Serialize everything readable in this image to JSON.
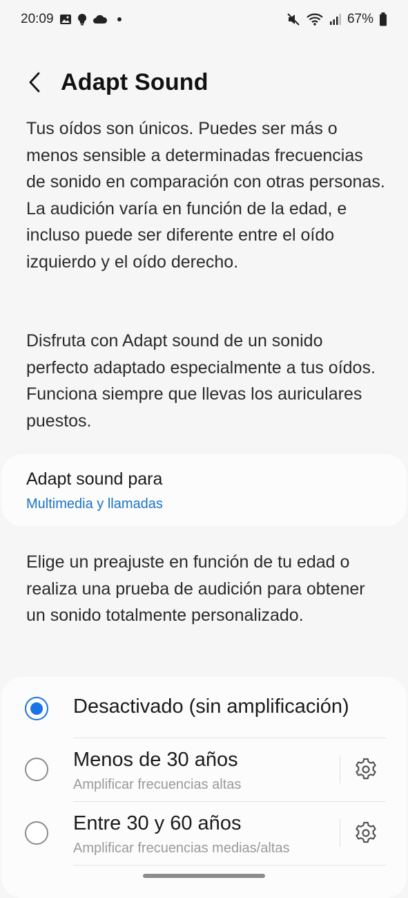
{
  "status_bar": {
    "time": "20:09",
    "battery": "67%",
    "left_icons": [
      "gallery-icon",
      "bulb-icon",
      "cloud-icon",
      "dot-icon"
    ],
    "right_icons": [
      "mute-icon",
      "wifi-icon",
      "signal-icon",
      "battery-icon"
    ]
  },
  "header": {
    "back_icon": "back-arrow-icon",
    "title": "Adapt Sound"
  },
  "intro": {
    "paragraph1": "Tus oídos son únicos. Puedes ser más o menos sensible a determinadas frecuencias de sonido en comparación con otras personas. La audición varía en función de la edad, e incluso puede ser diferente entre el oído izquierdo y el oído derecho.",
    "paragraph2": "Disfruta con Adapt sound de un sonido perfecto adaptado especialmente a tus oídos. Funciona siempre que llevas los auriculares puestos."
  },
  "adapt_for": {
    "title": "Adapt sound para",
    "value": "Multimedia y llamadas"
  },
  "preset_hint": "Elige un preajuste en función de tu edad o realiza una prueba de audición para obtener un sonido totalmente personalizado.",
  "options": [
    {
      "title": "Desactivado (sin amplificación)",
      "subtitle": "",
      "selected": true,
      "has_settings": false
    },
    {
      "title": "Menos de 30 años",
      "subtitle": "Amplificar frecuencias altas",
      "selected": false,
      "has_settings": true
    },
    {
      "title": "Entre 30 y 60 años",
      "subtitle": "Amplificar frecuencias medias/altas",
      "selected": false,
      "has_settings": true
    }
  ],
  "colors": {
    "accent": "#1a73e8",
    "link": "#1a73c7",
    "background": "#f6f6f6",
    "card": "#fcfcfc"
  }
}
